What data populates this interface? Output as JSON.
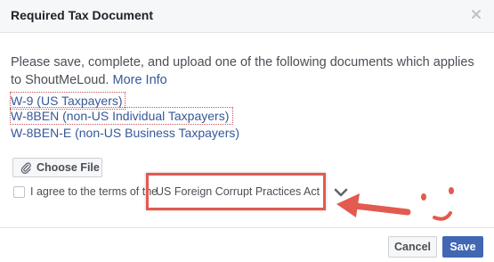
{
  "dialog": {
    "title": "Required Tax Document",
    "close_icon": "close-icon"
  },
  "body": {
    "description": "Please save, complete, and upload one of the following documents which applies to ShoutMeLoud.",
    "more_info": "More Info",
    "documents": [
      "W-9 (US Taxpayers)",
      "W-8BEN (non-US Individual Taxpayers)",
      "W-8BEN-E (non-US Business Taxpayers)"
    ],
    "choose_file_label": "Choose File",
    "choose_file_icon": "paperclip-icon",
    "agree_text": "I agree to the terms of the",
    "act_link": "US Foreign Corrupt Practices Act",
    "expand_icon": "chevron-down-icon"
  },
  "footer": {
    "cancel_label": "Cancel",
    "save_label": "Save"
  },
  "colors": {
    "link": "#365899",
    "primary_button": "#4267b2",
    "annotation": "#e35a4f"
  }
}
